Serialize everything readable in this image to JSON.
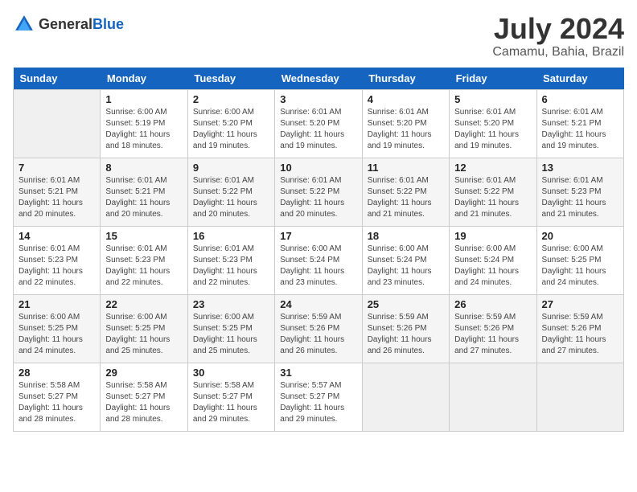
{
  "header": {
    "logo_general": "General",
    "logo_blue": "Blue",
    "month_year": "July 2024",
    "location": "Camamu, Bahia, Brazil"
  },
  "weekdays": [
    "Sunday",
    "Monday",
    "Tuesday",
    "Wednesday",
    "Thursday",
    "Friday",
    "Saturday"
  ],
  "weeks": [
    [
      {
        "day": "",
        "info": ""
      },
      {
        "day": "1",
        "info": "Sunrise: 6:00 AM\nSunset: 5:19 PM\nDaylight: 11 hours\nand 18 minutes."
      },
      {
        "day": "2",
        "info": "Sunrise: 6:00 AM\nSunset: 5:20 PM\nDaylight: 11 hours\nand 19 minutes."
      },
      {
        "day": "3",
        "info": "Sunrise: 6:01 AM\nSunset: 5:20 PM\nDaylight: 11 hours\nand 19 minutes."
      },
      {
        "day": "4",
        "info": "Sunrise: 6:01 AM\nSunset: 5:20 PM\nDaylight: 11 hours\nand 19 minutes."
      },
      {
        "day": "5",
        "info": "Sunrise: 6:01 AM\nSunset: 5:20 PM\nDaylight: 11 hours\nand 19 minutes."
      },
      {
        "day": "6",
        "info": "Sunrise: 6:01 AM\nSunset: 5:21 PM\nDaylight: 11 hours\nand 19 minutes."
      }
    ],
    [
      {
        "day": "7",
        "info": "Sunrise: 6:01 AM\nSunset: 5:21 PM\nDaylight: 11 hours\nand 20 minutes."
      },
      {
        "day": "8",
        "info": "Sunrise: 6:01 AM\nSunset: 5:21 PM\nDaylight: 11 hours\nand 20 minutes."
      },
      {
        "day": "9",
        "info": "Sunrise: 6:01 AM\nSunset: 5:22 PM\nDaylight: 11 hours\nand 20 minutes."
      },
      {
        "day": "10",
        "info": "Sunrise: 6:01 AM\nSunset: 5:22 PM\nDaylight: 11 hours\nand 20 minutes."
      },
      {
        "day": "11",
        "info": "Sunrise: 6:01 AM\nSunset: 5:22 PM\nDaylight: 11 hours\nand 21 minutes."
      },
      {
        "day": "12",
        "info": "Sunrise: 6:01 AM\nSunset: 5:22 PM\nDaylight: 11 hours\nand 21 minutes."
      },
      {
        "day": "13",
        "info": "Sunrise: 6:01 AM\nSunset: 5:23 PM\nDaylight: 11 hours\nand 21 minutes."
      }
    ],
    [
      {
        "day": "14",
        "info": "Sunrise: 6:01 AM\nSunset: 5:23 PM\nDaylight: 11 hours\nand 22 minutes."
      },
      {
        "day": "15",
        "info": "Sunrise: 6:01 AM\nSunset: 5:23 PM\nDaylight: 11 hours\nand 22 minutes."
      },
      {
        "day": "16",
        "info": "Sunrise: 6:01 AM\nSunset: 5:23 PM\nDaylight: 11 hours\nand 22 minutes."
      },
      {
        "day": "17",
        "info": "Sunrise: 6:00 AM\nSunset: 5:24 PM\nDaylight: 11 hours\nand 23 minutes."
      },
      {
        "day": "18",
        "info": "Sunrise: 6:00 AM\nSunset: 5:24 PM\nDaylight: 11 hours\nand 23 minutes."
      },
      {
        "day": "19",
        "info": "Sunrise: 6:00 AM\nSunset: 5:24 PM\nDaylight: 11 hours\nand 24 minutes."
      },
      {
        "day": "20",
        "info": "Sunrise: 6:00 AM\nSunset: 5:25 PM\nDaylight: 11 hours\nand 24 minutes."
      }
    ],
    [
      {
        "day": "21",
        "info": "Sunrise: 6:00 AM\nSunset: 5:25 PM\nDaylight: 11 hours\nand 24 minutes."
      },
      {
        "day": "22",
        "info": "Sunrise: 6:00 AM\nSunset: 5:25 PM\nDaylight: 11 hours\nand 25 minutes."
      },
      {
        "day": "23",
        "info": "Sunrise: 6:00 AM\nSunset: 5:25 PM\nDaylight: 11 hours\nand 25 minutes."
      },
      {
        "day": "24",
        "info": "Sunrise: 5:59 AM\nSunset: 5:26 PM\nDaylight: 11 hours\nand 26 minutes."
      },
      {
        "day": "25",
        "info": "Sunrise: 5:59 AM\nSunset: 5:26 PM\nDaylight: 11 hours\nand 26 minutes."
      },
      {
        "day": "26",
        "info": "Sunrise: 5:59 AM\nSunset: 5:26 PM\nDaylight: 11 hours\nand 27 minutes."
      },
      {
        "day": "27",
        "info": "Sunrise: 5:59 AM\nSunset: 5:26 PM\nDaylight: 11 hours\nand 27 minutes."
      }
    ],
    [
      {
        "day": "28",
        "info": "Sunrise: 5:58 AM\nSunset: 5:27 PM\nDaylight: 11 hours\nand 28 minutes."
      },
      {
        "day": "29",
        "info": "Sunrise: 5:58 AM\nSunset: 5:27 PM\nDaylight: 11 hours\nand 28 minutes."
      },
      {
        "day": "30",
        "info": "Sunrise: 5:58 AM\nSunset: 5:27 PM\nDaylight: 11 hours\nand 29 minutes."
      },
      {
        "day": "31",
        "info": "Sunrise: 5:57 AM\nSunset: 5:27 PM\nDaylight: 11 hours\nand 29 minutes."
      },
      {
        "day": "",
        "info": ""
      },
      {
        "day": "",
        "info": ""
      },
      {
        "day": "",
        "info": ""
      }
    ]
  ]
}
